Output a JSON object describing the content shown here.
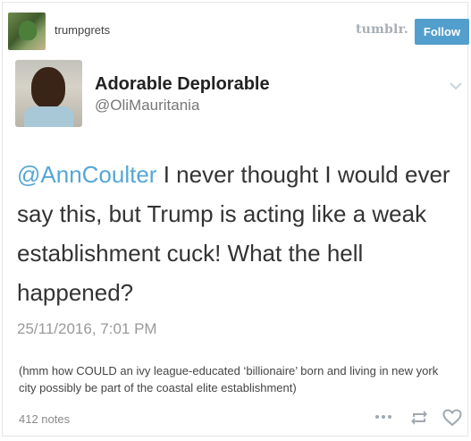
{
  "header": {
    "blog_name": "trumpgrets",
    "logo": "tumblr.",
    "follow_label": "Follow",
    "follow_color": "#529ecc"
  },
  "tweet": {
    "name": "Adorable Deplorable",
    "handle": "@OliMauritania",
    "mention": "@AnnCoulter",
    "text": " I never thought I would ever say this, but Trump is acting like a weak establishment  cuck! What the hell happened?",
    "date": "25/11/2016, 7:01 PM",
    "mention_color": "#55a7d5"
  },
  "caption": "(hmm how COULD an ivy league-educated ‘billionaire’ born and living in new york city possibly be part of the coastal elite establishment)",
  "footer": {
    "notes": "412 notes",
    "icons": [
      "more-icon",
      "reblog-icon",
      "heart-icon"
    ]
  }
}
